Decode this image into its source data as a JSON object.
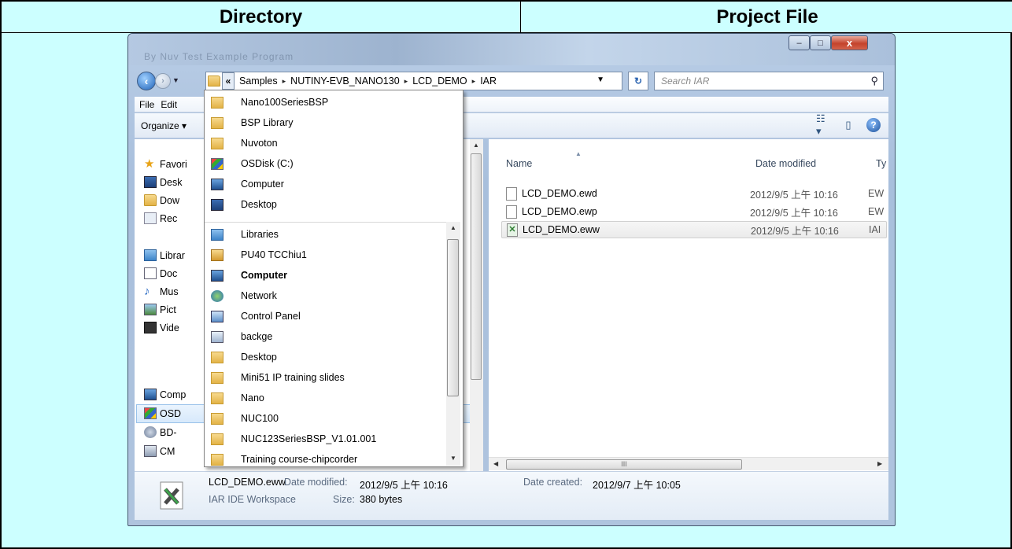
{
  "header": {
    "directory": "Directory",
    "project_file": "Project File"
  },
  "window": {
    "blurred_title": "By Nuv Test Example Program",
    "caption": {
      "minimize": "–",
      "maximize": "□",
      "close": "x"
    },
    "address": {
      "chevron": "«",
      "crumbs": [
        "Samples",
        "NUTINY-EVB_NANO130",
        "LCD_DEMO",
        "IAR"
      ],
      "separator": "▸"
    },
    "refresh_icon": "refresh-icon",
    "search_placeholder": "Search IAR",
    "menu": [
      "File",
      "Edit"
    ],
    "toolbar": {
      "organize": "Organize ▾"
    },
    "nav_pane": {
      "items": [
        {
          "label": "Favori",
          "icon": "star-icon"
        },
        {
          "label": "Desk",
          "icon": "desktop-icon"
        },
        {
          "label": "Dow",
          "icon": "downloads-icon"
        },
        {
          "label": "Rec",
          "icon": "recent-icon"
        },
        {
          "label": "Librar",
          "icon": "libraries-icon"
        },
        {
          "label": "Doc",
          "icon": "documents-icon"
        },
        {
          "label": "Mus",
          "icon": "music-icon"
        },
        {
          "label": "Pict",
          "icon": "pictures-icon"
        },
        {
          "label": "Vide",
          "icon": "videos-icon"
        },
        {
          "label": "Comp",
          "icon": "computer-icon"
        },
        {
          "label": "OSD",
          "icon": "osdisk-icon"
        },
        {
          "label": "BD-",
          "icon": "bd-drive-icon"
        },
        {
          "label": "CM",
          "icon": "network-drive-icon"
        }
      ]
    },
    "content": {
      "columns": {
        "name": "Name",
        "date": "Date modified",
        "type": "Ty"
      },
      "files": [
        {
          "name": "LCD_DEMO.ewd",
          "date": "2012/9/5 上午 10:16",
          "type": "EW"
        },
        {
          "name": "LCD_DEMO.ewp",
          "date": "2012/9/5 上午 10:16",
          "type": "EW"
        },
        {
          "name": "LCD_DEMO.eww",
          "date": "2012/9/5 上午 10:16",
          "type": "IAI"
        }
      ],
      "hscroll_grip": "III"
    },
    "details": {
      "filename": "LCD_DEMO.eww",
      "modified_label": "Date modified:",
      "modified_value": "2012/9/5 上午 10:16",
      "created_label": "Date created:",
      "created_value": "2012/9/7 上午 10:05",
      "type": "IAR IDE Workspace",
      "size_label": "Size:",
      "size_value": "380 bytes"
    },
    "dropdown": {
      "recent": [
        {
          "label": "Nano100SeriesBSP",
          "icon": "folder-icon"
        },
        {
          "label": "BSP Library",
          "icon": "folder-icon"
        },
        {
          "label": "Nuvoton",
          "icon": "folder-icon"
        },
        {
          "label": "OSDisk (C:)",
          "icon": "osdisk-icon"
        },
        {
          "label": "Computer",
          "icon": "computer-icon"
        },
        {
          "label": "Desktop",
          "icon": "desktop-icon"
        }
      ],
      "locations": [
        {
          "label": "Libraries",
          "icon": "libraries-icon",
          "bold": false
        },
        {
          "label": "PU40 TCChiu1",
          "icon": "user-folder-icon",
          "bold": false
        },
        {
          "label": "Computer",
          "icon": "computer-icon",
          "bold": true
        },
        {
          "label": "Network",
          "icon": "network-icon",
          "bold": false
        },
        {
          "label": "Control Panel",
          "icon": "control-panel-icon",
          "bold": false
        },
        {
          "label": "backge",
          "icon": "recycle-bin-icon",
          "bold": false
        },
        {
          "label": "Desktop",
          "icon": "folder-icon",
          "bold": false
        },
        {
          "label": "Mini51 IP training slides",
          "icon": "folder-icon",
          "bold": false
        },
        {
          "label": "Nano",
          "icon": "folder-icon",
          "bold": false
        },
        {
          "label": "NUC100",
          "icon": "folder-icon",
          "bold": false
        },
        {
          "label": "NUC123SeriesBSP_V1.01.001",
          "icon": "folder-icon",
          "bold": false
        },
        {
          "label": "Training course-chipcorder",
          "icon": "folder-icon",
          "bold": false
        }
      ]
    }
  }
}
